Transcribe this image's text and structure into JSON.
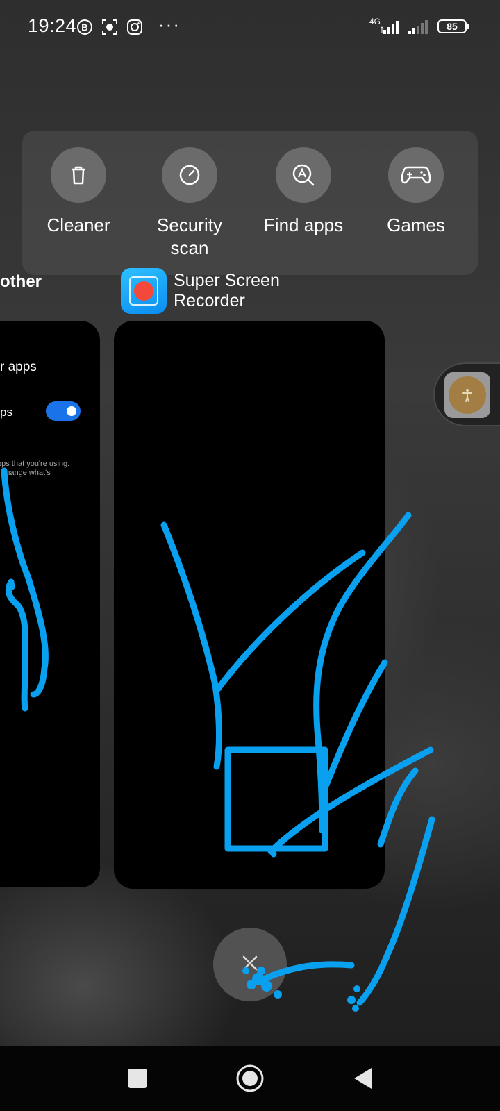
{
  "status_bar": {
    "time": "19:24",
    "icons": [
      "b-badge-icon",
      "screen-record-icon",
      "instagram-icon"
    ],
    "more": "···",
    "network": "4G",
    "battery": "85"
  },
  "quick_tools": [
    {
      "label": "Cleaner",
      "icon": "trash-icon"
    },
    {
      "label": "Security\nscan",
      "icon": "security-scan-icon"
    },
    {
      "label": "Find apps",
      "icon": "find-apps-icon"
    },
    {
      "label": "Games",
      "icon": "gamepad-icon"
    }
  ],
  "recent_cards": {
    "left": {
      "title": "other",
      "line1": "r apps",
      "line2": "ps",
      "toggle_on": true,
      "desc": "pps that you're using.\nr change what's"
    },
    "main": {
      "app_name": "Super Screen\nRecorder",
      "icon": "super-screen-recorder-icon"
    }
  },
  "floating_button": {
    "icon": "accessibility-icon"
  },
  "clear_button": {
    "icon": "close-icon"
  },
  "nav_bar": {
    "buttons": [
      "recents-square-icon",
      "home-circle-icon",
      "back-triangle-icon"
    ]
  },
  "colors": {
    "accent_toggle": "#1a73e8",
    "scribble": "#0aa0f0",
    "recorder_icon": "#0a8df0",
    "recorder_dot": "#f4483a"
  }
}
